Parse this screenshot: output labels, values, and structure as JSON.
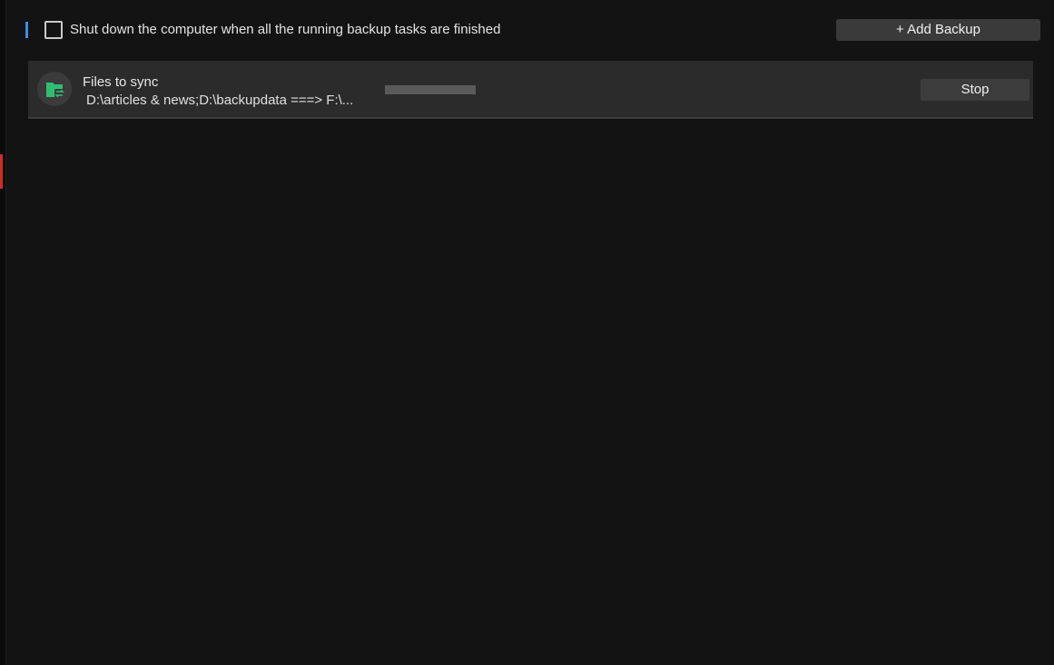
{
  "options": {
    "shutdown_label": "Shut down the computer when all the running backup tasks are finished",
    "shutdown_checked": false
  },
  "toolbar": {
    "add_backup_label": "+ Add Backup"
  },
  "tasks": [
    {
      "title": "Files to sync",
      "path": "D:\\articles & news;D:\\backupdata ===> F:\\...",
      "icon": "folder-sync-icon",
      "progress_fraction": 0.0,
      "stop_label": "Stop"
    }
  ],
  "colors": {
    "background": "#131313",
    "card": "#2b2b2b",
    "accent_blue": "#3a8ee6",
    "accent_red": "#d62a2a",
    "icon_green": "#2fbf71"
  }
}
